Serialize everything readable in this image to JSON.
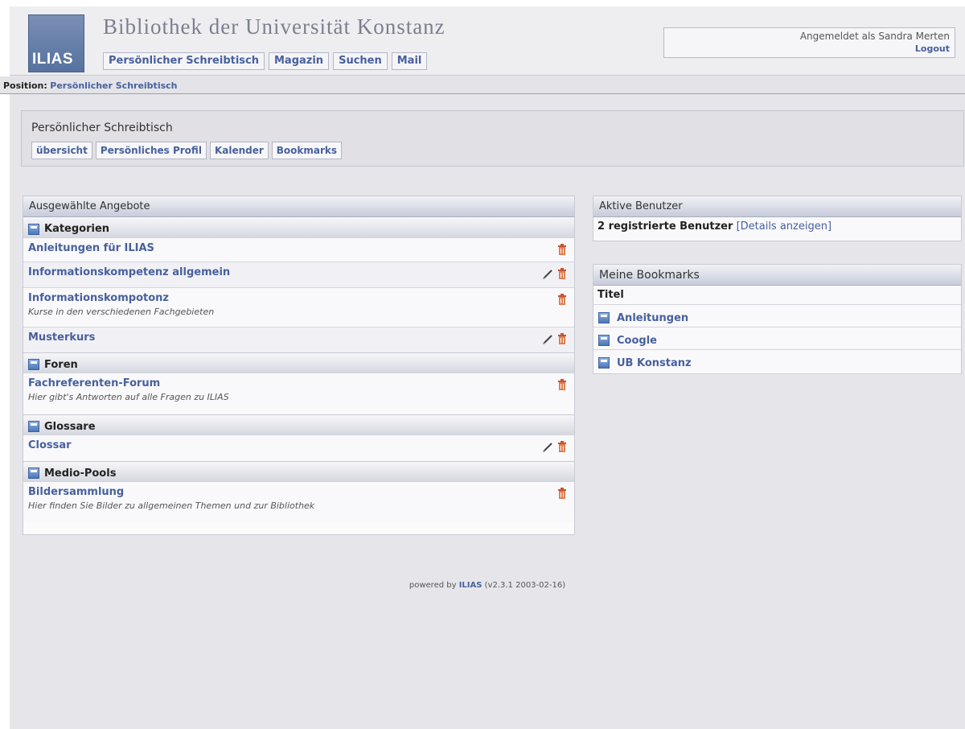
{
  "header": {
    "logo_text": "ILIAS",
    "site_title": "Bibliothek der Universität Konstanz",
    "nav": [
      "Persönlicher Schreibtisch",
      "Magazin",
      "Suchen",
      "Mail"
    ],
    "logged_in_as": "Angemeldet als Sandra Merten",
    "logout": "Logout"
  },
  "locator": {
    "label": "Position:",
    "link": "Persönlicher Schreibtisch"
  },
  "desktop": {
    "title": "Persönlicher Schreibtisch",
    "tabs": [
      "übersicht",
      "Persönliches Profil",
      "Kalender",
      "Bookmarks"
    ]
  },
  "selected_offers": {
    "title": "Ausgewählte Angebote",
    "categories": [
      {
        "label": "Kategorien",
        "icon": "category-icon"
      },
      {
        "label": "Foren",
        "icon": "forum-icon"
      },
      {
        "label": "Glossare",
        "icon": "glossary-icon"
      },
      {
        "label": "Medio-Pools",
        "icon": "media-pool-icon"
      }
    ],
    "items": [
      {
        "title": "Anleitungen für ILIAS",
        "desc": "",
        "edit": false
      },
      {
        "title": "Informationskompetenz allgemein",
        "desc": "",
        "edit": true
      },
      {
        "title": "Informationskompotonz",
        "desc": "Kurse in den verschiedenen Fachgebieten",
        "edit": false
      },
      {
        "title": "Musterkurs",
        "desc": "",
        "edit": true
      },
      {
        "title": "Fachreferenten-Forum",
        "desc": "Hier gibt's Antworten auf alle Fragen zu ILIAS",
        "edit": false
      },
      {
        "title": "Clossar",
        "desc": "",
        "edit": true
      },
      {
        "title": "Bildersammlung",
        "desc": "Hier finden Sie Bilder zu allgemeinen Themen und zur Bibliothek",
        "edit": false
      }
    ]
  },
  "active_users": {
    "title": "Aktive Benutzer",
    "count_text": "2 registrierte Benutzer",
    "details_link": "[Details anzeigen]"
  },
  "bookmarks": {
    "title": "Meine Bookmarks",
    "column_header": "Titel",
    "items": [
      {
        "label": "Anleitungen",
        "icon": "folder-icon"
      },
      {
        "label": "Coogle",
        "icon": "bookmark-icon"
      },
      {
        "label": "UB Konstanz",
        "icon": "bookmark-icon"
      }
    ]
  },
  "footer": {
    "prefix": "powered by",
    "brand": "ILIAS",
    "version": "(v2.3.1 2003-02-16)"
  },
  "colors": {
    "link": "#48609c",
    "background": "#e6e6ea",
    "header_gradient_dark": "#c7ccdb",
    "trash": "#d66b43"
  }
}
